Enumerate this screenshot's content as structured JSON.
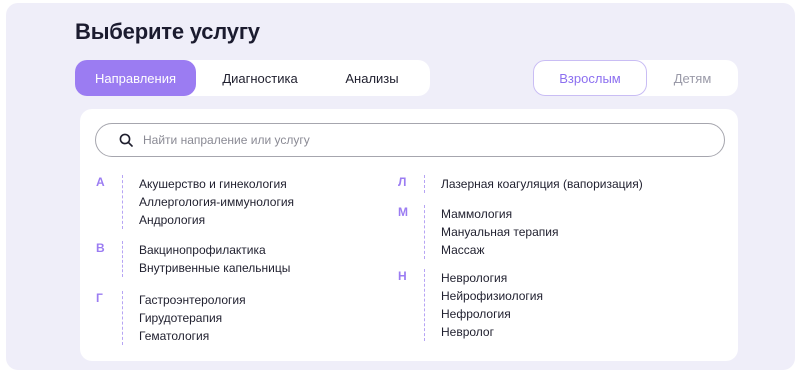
{
  "page": {
    "title": "Выберите услугу"
  },
  "tabs": [
    {
      "label": "Направления",
      "active": true
    },
    {
      "label": "Диагностика",
      "active": false
    },
    {
      "label": "Анализы",
      "active": false
    }
  ],
  "audience": [
    {
      "label": "Взрослым",
      "active": true
    },
    {
      "label": "Детям",
      "active": false
    }
  ],
  "search": {
    "placeholder": "Найти напраление или услугу",
    "icon": "search-icon"
  },
  "groups_left": [
    {
      "letter": "А",
      "items": [
        "Акушерство и гинекология",
        "Аллергология-иммунология",
        "Андрология"
      ]
    },
    {
      "letter": "В",
      "items": [
        "Вакцинопрофилактика",
        "Внутривенные капельницы"
      ]
    },
    {
      "letter": "Г",
      "items": [
        "Гастроэнтерология",
        "Гирудотерапия",
        "Гематология"
      ]
    }
  ],
  "groups_right": [
    {
      "letter": "Л",
      "items": [
        "Лазерная коагуляция (вапоризация)"
      ]
    },
    {
      "letter": "М",
      "items": [
        "Маммология",
        "Мануальная терапия",
        "Массаж"
      ]
    },
    {
      "letter": "Н",
      "items": [
        "Неврология",
        "Нейрофизиология",
        "Нефрология",
        "Невролог"
      ]
    }
  ],
  "colors": {
    "accent": "#9b7cf2",
    "panel_bg": "#efeef9",
    "text": "#1f1f2e"
  }
}
